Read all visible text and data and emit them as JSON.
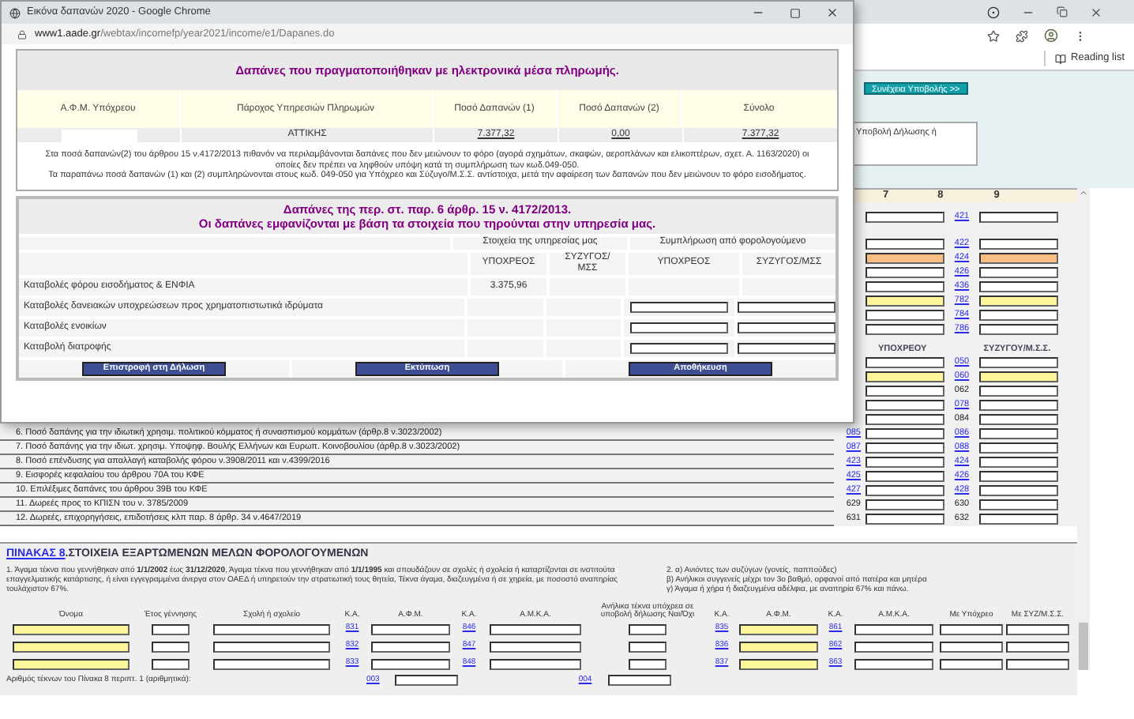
{
  "browser": {
    "reading_list": "Reading list"
  },
  "page": {
    "continue_button": "Συνέχεια Υποβολής >>",
    "note_value": "Υποβολή Δήλωσης ή",
    "column_headers": [
      "7",
      "8",
      "9"
    ],
    "upper_rows": [
      {
        "code": "421",
        "link": true,
        "color": "#ffffff"
      },
      {
        "code": "422",
        "link": true,
        "color": "#ffffff"
      },
      {
        "code": "424",
        "link": true,
        "color": "#f9be86"
      },
      {
        "code": "426",
        "link": true,
        "color": "#ffffff"
      },
      {
        "code": "436",
        "link": true,
        "color": "#ffffff"
      },
      {
        "code": "782",
        "link": true,
        "color": "#fdf59a"
      },
      {
        "code": "784",
        "link": true,
        "color": "#ffffff"
      },
      {
        "code": "786",
        "link": true,
        "color": "#ffffff"
      }
    ],
    "section_headers": [
      "ΥΠΟΧΡΕΟΥ",
      "ΣΥΖΥΓΟΥ/Μ.Σ.Σ."
    ],
    "lower_rows": [
      {
        "code": "050",
        "link": true,
        "color": "#ffffff"
      },
      {
        "code": "060",
        "link": true,
        "color": "#fdf59a"
      },
      {
        "code": "062",
        "link": false,
        "color": "#ffffff"
      },
      {
        "code": "078",
        "link": true,
        "color": "#ffffff"
      },
      {
        "code": "084",
        "link": false,
        "color": "#ffffff"
      },
      {
        "label": "6. Ποσό δαπάνης για την ιδιωτική χρησιμ. πολιτικού κόμματος ή συνασπισμού κομμάτων (άρθρ.8 ν.3023/2002)",
        "left_code": "085",
        "left_link": true,
        "code": "086",
        "link": true,
        "color": "#ffffff"
      },
      {
        "label": "7. Ποσό δαπάνης για την ιδιωτ. χρησιμ. Υποψηφ. Βουλής Ελλήνων και Ευρωπ. Κοινοβουλίου (άρθρ.8 ν.3023/2002)",
        "left_code": "087",
        "left_link": true,
        "code": "088",
        "link": true,
        "color": "#ffffff"
      },
      {
        "label": "8. Ποσό επένδυσης για απαλλαγή καταβολής φόρου ν.3908/2011 και ν.4399/2016",
        "left_code": "423",
        "left_link": true,
        "code": "424",
        "link": true,
        "color": "#ffffff"
      },
      {
        "label": "9. Εισφορές κεφαλαίου του άρθρου 70Α του ΚΦΕ",
        "left_code": "425",
        "left_link": true,
        "code": "426",
        "link": true,
        "color": "#ffffff"
      },
      {
        "label": "10. Επιλέξιμες δαπάνες του άρθρου 39Β του ΚΦΕ",
        "left_code": "427",
        "left_link": true,
        "code": "428",
        "link": true,
        "color": "#ffffff"
      },
      {
        "label": "11. Δωρεές προς το ΚΠΙΣΝ του ν. 3785/2009",
        "left_code": "629",
        "left_link": false,
        "code": "630",
        "link": false,
        "color": "#ffffff"
      },
      {
        "label": "12. Δωρεές, επιχορηγήσεις, επιδοτήσεις κλπ παρ. 8 άρθρ. 34 ν.4647/2019",
        "left_code": "631",
        "left_link": false,
        "code": "632",
        "link": false,
        "color": "#ffffff"
      }
    ]
  },
  "table8": {
    "title_link": "ΠΙΝΑΚΑΣ 8",
    "title": ".ΣΤΟΙΧΕΙΑ ΕΞΑΡΤΩΜΕΝΩΝ ΜΕΛΩΝ ΦΟΡΟΛΟΓΟΥΜΕΝΩΝ",
    "note_left": "1. Άγαμα τέκνα που γεννήθηκαν από **1/1/2002** έως **31/12/2020**, Άγαμα τέκνα που γεννήθηκαν από **1/1/1995** και σπουδάζουν σε σχολές ή σχολεία ή καταρτίζονται σε ινστιτούτα επαγγελματικής κατάρτισης, ή είναι εγγεγραμμένα άνεργα στον ΟΑΕΔ ή υπηρετούν την στρατιωτική τους θητεία, Τέκνα άγαμα, διαζευγμένα ή σε χηρεία, με ποσοστό αναπηρίας τουλάχιστον 67%.",
    "notes_right": [
      "2. α) Ανιόντες των συζύγων (γονείς, παππούδες)",
      "β) Ανήλικοι συγγενείς μέχρι τον 3ο βαθμό, ορφανοί από πατέρα και μητέρα",
      "γ) Άγαμα ή χήρα ή διαζευγμένα αδέλφια, με αναπηρία 67% και πάνω."
    ],
    "columns": [
      "Όνομα",
      "Έτος γέννησης",
      "Σχολή ή σχολείο",
      "Κ.Α.",
      "Α.Φ.Μ.",
      "Κ.Α.",
      "Α.Μ.Κ.Α.",
      "Ανήλικα τέκνα υπόχρεα σε υποβολή δήλωσης Ναι/Όχι",
      "Κ.Α.",
      "Α.Φ.Μ.",
      "Κ.Α.",
      "Α.Μ.Κ.Α.",
      "Με Υπόχρεο",
      "Με ΣΥΖ/Μ.Σ.Σ."
    ],
    "rows": [
      {
        "codes": [
          "831",
          "846",
          "835",
          "861"
        ]
      },
      {
        "codes": [
          "832",
          "847",
          "836",
          "862"
        ]
      },
      {
        "codes": [
          "833",
          "848",
          "837",
          "863"
        ]
      }
    ],
    "footer_label": "Αριθμός τέκνων του Πίνακα 8 περιπτ. 1 (αριθμητικά):",
    "footer_codes": [
      "003",
      "004"
    ]
  },
  "popup": {
    "title": "Εικόνα δαπανών 2020 - Google Chrome",
    "url_host": "www1.aade.gr",
    "url_path": "/webtax/incomefp/year2021/income/e1/Dapanes.do",
    "heading": "Δαπάνες που πραγματοποιήθηκαν με ηλεκτρονικά μέσα πληρωμής.",
    "columns": [
      "Α.Φ.Μ. Υπόχρεου",
      "Πάροχος Υπηρεσιών Πληρωμών",
      "Ποσό Δαπανών (1)",
      "Ποσό Δαπανών (2)",
      "Σύνολο"
    ],
    "row": {
      "provider": "ΑΤΤΙΚΗΣ",
      "amount_1": "7.377,32",
      "amount_2": "0,00",
      "total": "7.377,32"
    },
    "notes": [
      "Στα ποσά δαπανών(2) του άρθρου 15 ν.4172/2013 πιθανόν να περιλαμβάνονται δαπάνες που δεν μειώνουν το φόρο (αγορά σχημάτων, σκαφών, αεροπλάνων και ελικοπτέρων, σχετ. Α. 1163/2020) οι οποίες δεν πρέπει να ληφθούν υπόψη κατά τη συμπλήρωση των κωδ.049-050.",
      "Τα παραπάνω ποσά δαπανών (1) και (2) συμπληρώνονται στους κωδ. 049-050 για Υπόχρεο και Σύζυγο/Μ.Σ.Σ. αντίστοιχα, μετά την αφαίρεση των δαπανών που δεν μειώνουν το φόρο εισοδήματος."
    ],
    "heading2": [
      "Δαπάνες της περ. στ. παρ. 6 άρθρ. 15 ν. 4172/2013.",
      "Οι δαπάνες εμφανίζονται με βάση τα στοιχεία που τηρούνται στην υπηρεσία μας."
    ],
    "groups": [
      "Στοιχεία της υπηρεσίας μας",
      "Συμπλήρωση από φορολογούμενο"
    ],
    "subcolumns": [
      "ΥΠΟΧΡΕΟΣ",
      "ΣΥΖΥΓΟΣ/ΜΣΣ",
      "ΥΠΟΧΡΕΟΣ",
      "ΣΥΖΥΓΟΣ/ΜΣΣ"
    ],
    "payments": [
      {
        "kind": "service",
        "label": "Καταβολές φόρου εισοδήματος & ΕΝΦΙΑ",
        "taxpayer": "3.375,96"
      },
      {
        "kind": "input",
        "label": "Καταβολές δανειακών υποχρεώσεων προς χρηματοπιστωτικά ιδρύματα"
      },
      {
        "kind": "input",
        "label": "Καταβολές ενοικίων"
      },
      {
        "kind": "input",
        "label": "Καταβολή διατροφής"
      }
    ],
    "buttons": [
      "Επιστροφή στη Δήλωση",
      "Εκτύπωση",
      "Αποθήκευση"
    ]
  }
}
